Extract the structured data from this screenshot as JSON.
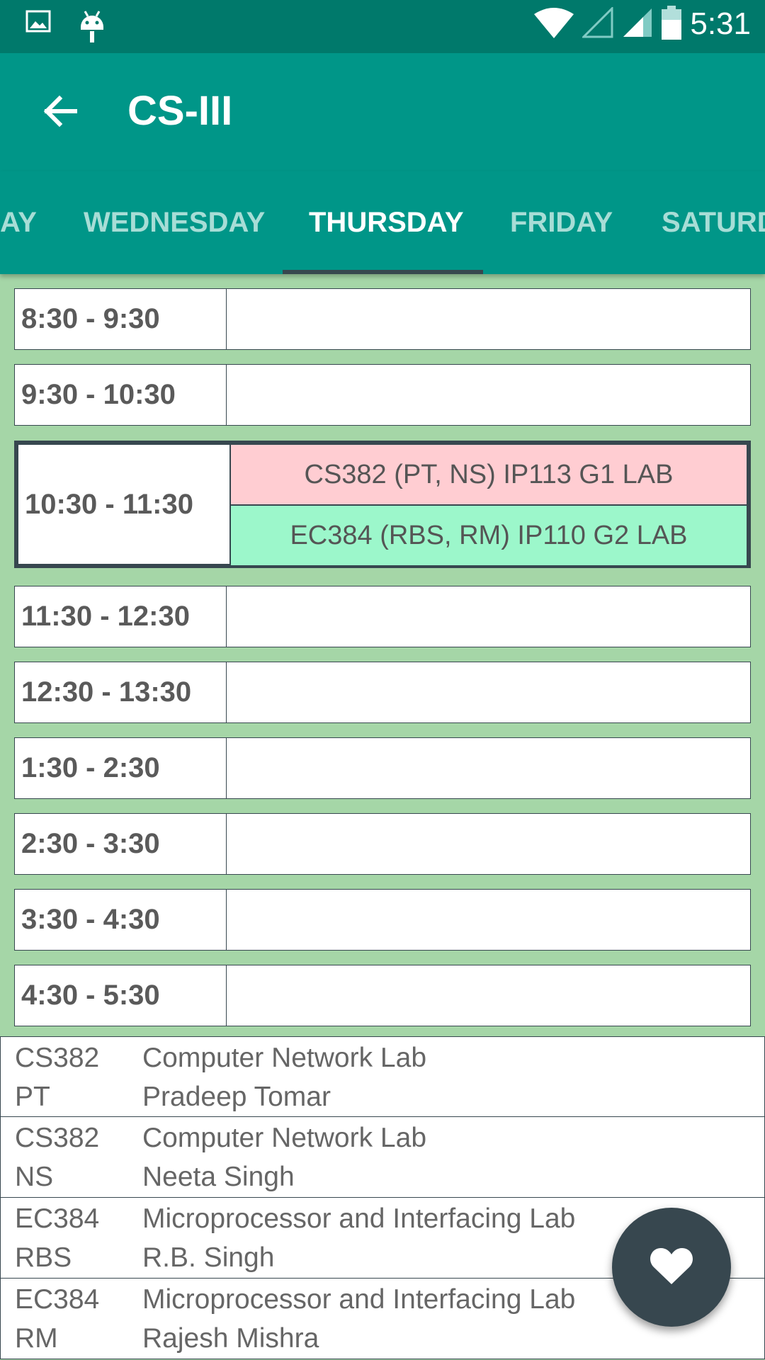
{
  "status_bar": {
    "time": "5:31",
    "icons": [
      "image-icon",
      "android-icon",
      "wifi-icon",
      "signal-empty-icon",
      "signal-icon",
      "battery-icon"
    ]
  },
  "app_bar": {
    "title": "CS-III"
  },
  "tabs": [
    {
      "label": "AY"
    },
    {
      "label": "WEDNESDAY"
    },
    {
      "label": "THURSDAY",
      "active": true
    },
    {
      "label": "FRIDAY"
    },
    {
      "label": "SATURD"
    }
  ],
  "schedule": [
    {
      "time": "8:30 - 9:30"
    },
    {
      "time": "9:30 - 10:30"
    },
    {
      "time": "10:30 - 11:30",
      "classes": [
        {
          "text": "CS382 (PT, NS) IP113 G1 LAB",
          "color": "#FFCDD2"
        },
        {
          "text": "EC384 (RBS, RM) IP110 G2 LAB",
          "color": "#9CF7CB"
        }
      ]
    },
    {
      "time": "11:30 - 12:30"
    },
    {
      "time": "12:30 - 13:30"
    },
    {
      "time": "1:30 - 2:30"
    },
    {
      "time": "2:30 - 3:30"
    },
    {
      "time": "3:30 - 4:30"
    },
    {
      "time": "4:30 - 5:30"
    }
  ],
  "legend": [
    {
      "code": "CS382",
      "subject": "Computer Network Lab",
      "abbr": "PT",
      "teacher": "Pradeep Tomar"
    },
    {
      "code": "CS382",
      "subject": "Computer Network Lab",
      "abbr": "NS",
      "teacher": "Neeta Singh"
    },
    {
      "code": "EC384",
      "subject": "Microprocessor and Interfacing Lab",
      "abbr": "RBS",
      "teacher": "R.B. Singh"
    },
    {
      "code": "EC384",
      "subject": "Microprocessor and Interfacing Lab",
      "abbr": "RM",
      "teacher": "Rajesh Mishra"
    }
  ],
  "fab": {
    "icon": "heart-icon"
  },
  "colors": {
    "status_bar": "#00796B",
    "app_bar": "#009688",
    "background": "#A5D6A7",
    "fab": "#37474F"
  }
}
